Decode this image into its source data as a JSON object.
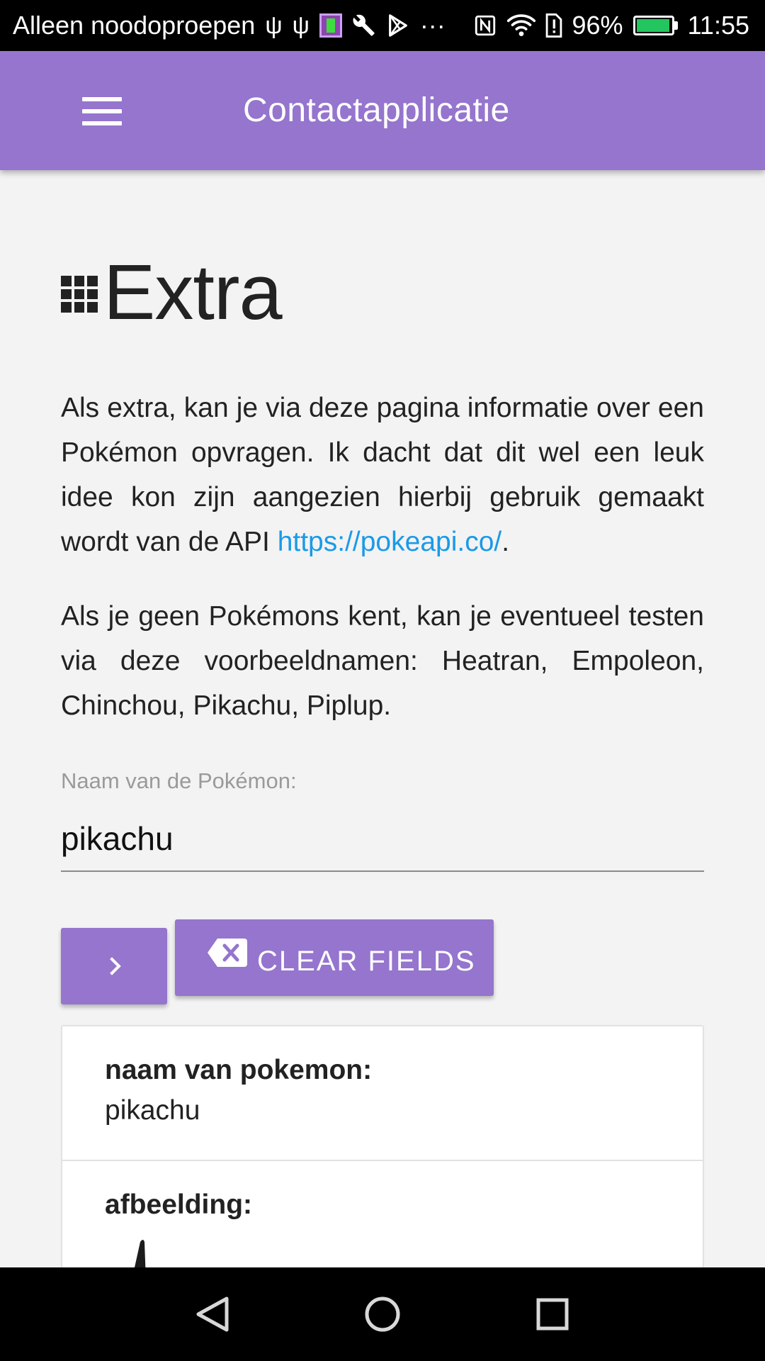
{
  "status_bar": {
    "carrier": "Alleen noodoproepen",
    "usb_icon": "⚲",
    "overflow": "···",
    "battery_percent": "96%",
    "battery_level": 0.96,
    "time": "11:55",
    "colors": {
      "battery": "#22c55e"
    }
  },
  "app_bar": {
    "title": "Contactapplicatie",
    "color": "#9575cd"
  },
  "page": {
    "title": "Extra",
    "intro_text": "Als extra, kan je via deze pagina informatie over een Pokémon opvragen. Ik dacht dat dit wel een leuk idee kon zijn aangezien hierbij gebruik gemaakt wordt van de API ",
    "api_link": "https://pokeapi.co/",
    "intro_end": ".",
    "examples_text": "Als je geen Pokémons kent, kan je eventueel testen via deze voorbeeldnamen: Heatran, Empoleon, Chinchou, Pikachu, Piplup."
  },
  "form": {
    "name_label": "Naam van de Pokémon:",
    "name_value": "pikachu",
    "clear_label": "CLEAR FIELDS"
  },
  "results": [
    {
      "key": "naam van pokemon:",
      "value": "pikachu"
    },
    {
      "key": "afbeelding:"
    }
  ],
  "icons": {
    "menu": "hamburger-icon",
    "title": "apps-icon",
    "submit": "chevron-right-icon",
    "clear": "backspace-icon",
    "nav": [
      "back-icon",
      "home-icon",
      "recents-icon"
    ]
  }
}
